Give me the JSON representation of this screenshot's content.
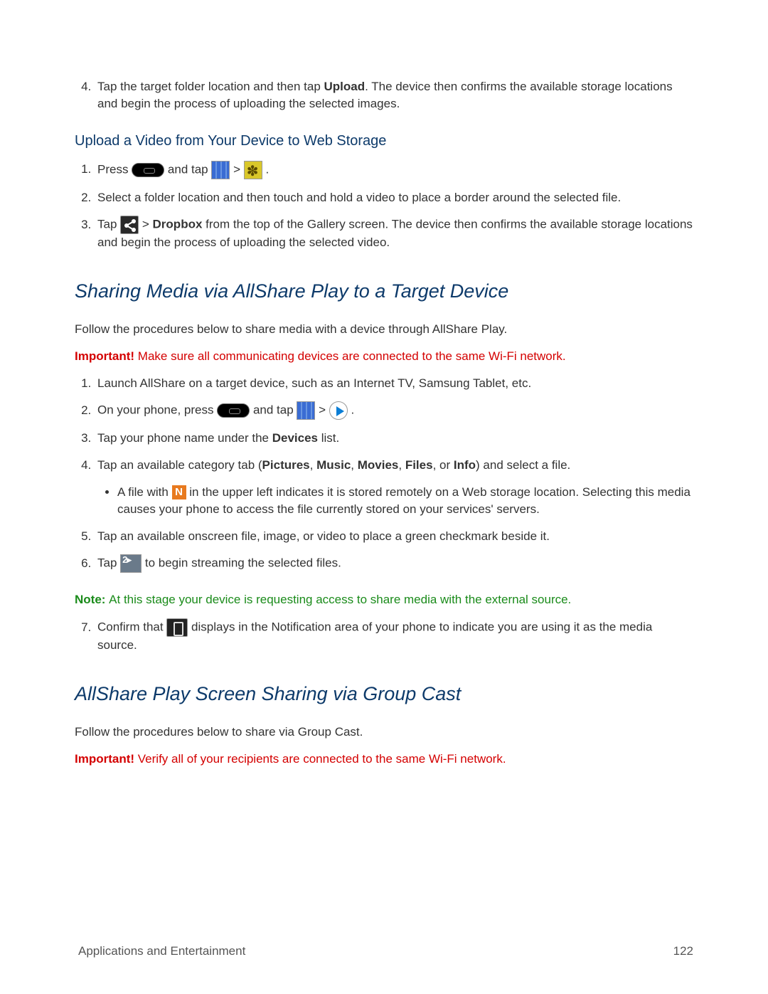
{
  "step4": {
    "prefix": "Tap the target folder location and then tap ",
    "bold": "Upload",
    "suffix": ". The device then confirms the available storage locations and begin the process of uploading the selected images."
  },
  "subheading1": "Upload a Video from Your Device to Web Storage",
  "upload_steps": {
    "s1_press": "Press ",
    "s1_andtap": " and tap ",
    "s1_gt": " > ",
    "s1_end": " .",
    "s2": "Select a folder location and then touch and hold a video to place a border around the selected file.",
    "s3_tap": "Tap ",
    "s3_gt": " > ",
    "s3_bold": "Dropbox",
    "s3_rest": " from the top of the Gallery screen. The device then confirms the available storage locations and begin the process of uploading the selected video."
  },
  "heading1": "Sharing Media via AllShare Play to a Target Device",
  "intro1": "Follow the procedures below to share media with a device through AllShare Play.",
  "important1_label": "Important! ",
  "important1_text": "Make sure all communicating devices are connected to the same Wi-Fi network.",
  "allshare": {
    "s1": "Launch AllShare on a target device, such as an Internet TV, Samsung Tablet, etc.",
    "s2_a": "On your phone, press ",
    "s2_b": " and tap ",
    "s2_gt": " > ",
    "s2_end": " .",
    "s3_a": "Tap your phone name under the ",
    "s3_bold": "Devices",
    "s3_b": " list.",
    "s4_a": "Tap an available category tab (",
    "s4_b1": "Pictures",
    "s4_c": ", ",
    "s4_b2": "Music",
    "s4_c2": ", ",
    "s4_b3": "Movies",
    "s4_c3": ", ",
    "s4_b4": "Files",
    "s4_c4": ", or ",
    "s4_b5": "Info",
    "s4_d": ") and select a file.",
    "sub_a": "A file with ",
    "sub_b": " in the upper left indicates it is stored remotely on a Web storage location. Selecting this media causes your phone to access the file currently stored on your services' servers.",
    "s5": "Tap an available onscreen file, image, or video to place a green checkmark beside it.",
    "s6_a": "Tap ",
    "s6_b": " to begin streaming the selected files.",
    "s7_a": "Confirm that ",
    "s7_b": " displays in the Notification area of your phone to indicate you are using it as the media source."
  },
  "note_label": "Note: ",
  "note_text": "At this stage your device is requesting access to share media with the external source.",
  "heading2": "AllShare Play Screen Sharing via Group Cast",
  "intro2": "Follow the procedures below to share via Group Cast.",
  "important2_label": "Important! ",
  "important2_text": "Verify all of your recipients are connected to the same Wi-Fi network.",
  "footer_left": "Applications and Entertainment",
  "footer_right": "122",
  "icon_n_label": "N"
}
